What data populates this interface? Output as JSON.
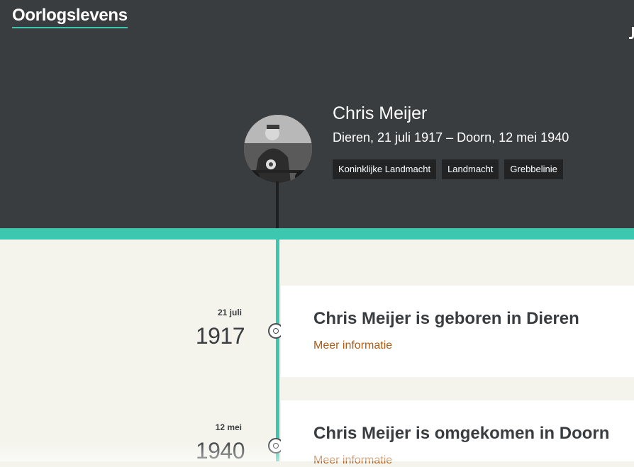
{
  "site": {
    "logo": "Oorlogslevens"
  },
  "person": {
    "name": "Chris Meijer",
    "lifespan": "Dieren, 21 juli 1917 – Doorn, 12 mei 1940",
    "tags": [
      "Koninklijke Landmacht",
      "Landmacht",
      "Grebbelinie"
    ]
  },
  "events": [
    {
      "day": "21 juli",
      "year": "1917",
      "title": "Chris Meijer is geboren in Dieren",
      "link": "Meer informatie"
    },
    {
      "day": "12 mei",
      "year": "1940",
      "title": "Chris Meijer is omgekomen in Doorn",
      "link": "Meer informatie"
    }
  ],
  "colors": {
    "header_bg": "#393d40",
    "accent": "#3cc8b0",
    "page_bg": "#f4f4ec",
    "link": "#b05a14",
    "tag_bg": "#212325"
  }
}
